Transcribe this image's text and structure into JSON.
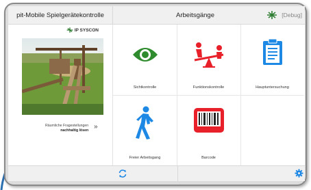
{
  "header": {
    "app_title": "pit-Mobile Spielgerätekontrolle",
    "section_title": "Arbeitsgänge",
    "debug_label": "[Debug]"
  },
  "brand": {
    "name": "IP SYSCON",
    "color": "#2e7d32"
  },
  "promo": {
    "line1": "Räumliche Fragestellungen",
    "line2": "nachhaltig lösen",
    "chevron": "»"
  },
  "tiles": [
    {
      "label": "Sichtkontrolle",
      "icon": "eye-icon",
      "color": "#2e8b2e"
    },
    {
      "label": "Funktionskontrolle",
      "icon": "seesaw-icon",
      "color": "#e8202a"
    },
    {
      "label": "Hauptuntersuchung",
      "icon": "clipboard-icon",
      "color": "#1e88e5"
    },
    {
      "label": "Freier Arbeitsgang",
      "icon": "walking-person-icon",
      "color": "#1e88e5"
    },
    {
      "label": "Barcode",
      "icon": "barcode-icon",
      "color": "#e8202a"
    }
  ],
  "footer": {
    "sync_icon": "sync-icon",
    "settings_icon": "gear-icon",
    "accent": "#1e88e5"
  }
}
